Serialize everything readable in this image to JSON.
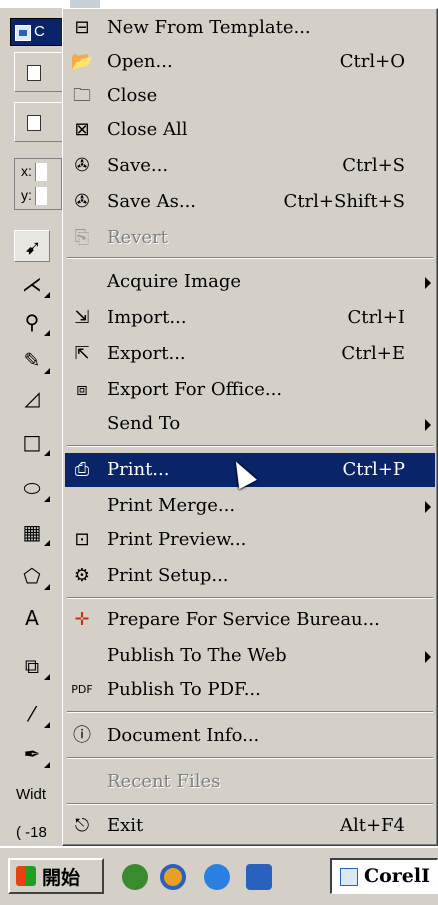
{
  "window": {
    "title_fragment": "C"
  },
  "left_panel": {
    "coords": {
      "x_label": "x:",
      "y_label": "y:"
    },
    "width_label": "Widt",
    "width_value": "( -18"
  },
  "menu": {
    "items": [
      {
        "label": "New From Template...",
        "shortcut": "",
        "icon": "new-from-template-icon",
        "submenu": false,
        "disabled": false
      },
      {
        "label": "Open...",
        "shortcut": "Ctrl+O",
        "icon": "open-icon",
        "submenu": false,
        "disabled": false
      },
      {
        "label": "Close",
        "shortcut": "",
        "icon": "close-doc-icon",
        "submenu": false,
        "disabled": false
      },
      {
        "label": "Close All",
        "shortcut": "",
        "icon": "close-all-icon",
        "submenu": false,
        "disabled": false
      },
      {
        "label": "Save...",
        "shortcut": "Ctrl+S",
        "icon": "save-icon",
        "submenu": false,
        "disabled": false
      },
      {
        "label": "Save As...",
        "shortcut": "Ctrl+Shift+S",
        "icon": "save-as-icon",
        "submenu": false,
        "disabled": false
      },
      {
        "label": "Revert",
        "shortcut": "",
        "icon": "revert-icon",
        "submenu": false,
        "disabled": true
      },
      {
        "label": "Acquire Image",
        "shortcut": "",
        "icon": "",
        "submenu": true,
        "disabled": false
      },
      {
        "label": "Import...",
        "shortcut": "Ctrl+I",
        "icon": "import-icon",
        "submenu": false,
        "disabled": false
      },
      {
        "label": "Export...",
        "shortcut": "Ctrl+E",
        "icon": "export-icon",
        "submenu": false,
        "disabled": false
      },
      {
        "label": "Export For Office...",
        "shortcut": "",
        "icon": "export-office-icon",
        "submenu": false,
        "disabled": false
      },
      {
        "label": "Send To",
        "shortcut": "",
        "icon": "",
        "submenu": true,
        "disabled": false
      },
      {
        "label": "Print...",
        "shortcut": "Ctrl+P",
        "icon": "print-icon",
        "submenu": false,
        "disabled": false,
        "highlighted": true
      },
      {
        "label": "Print Merge...",
        "shortcut": "",
        "icon": "",
        "submenu": true,
        "disabled": false
      },
      {
        "label": "Print Preview...",
        "shortcut": "",
        "icon": "print-preview-icon",
        "submenu": false,
        "disabled": false
      },
      {
        "label": "Print Setup...",
        "shortcut": "",
        "icon": "print-setup-icon",
        "submenu": false,
        "disabled": false
      },
      {
        "label": "Prepare For Service Bureau...",
        "shortcut": "",
        "icon": "service-bureau-icon",
        "submenu": false,
        "disabled": false
      },
      {
        "label": "Publish To The Web",
        "shortcut": "",
        "icon": "",
        "submenu": true,
        "disabled": false
      },
      {
        "label": "Publish To PDF...",
        "shortcut": "",
        "icon": "pdf-icon",
        "submenu": false,
        "disabled": false
      },
      {
        "label": "Document Info...",
        "shortcut": "",
        "icon": "info-icon",
        "submenu": false,
        "disabled": false
      },
      {
        "label": "Recent Files",
        "shortcut": "",
        "icon": "",
        "submenu": false,
        "disabled": true
      },
      {
        "label": "Exit",
        "shortcut": "Alt+F4",
        "icon": "exit-icon",
        "submenu": false,
        "disabled": false
      }
    ]
  },
  "taskbar": {
    "start_label": "開始",
    "task_label": "CorelI"
  },
  "colors": {
    "highlight": "#0a246a",
    "face": "#d4d0c8"
  }
}
